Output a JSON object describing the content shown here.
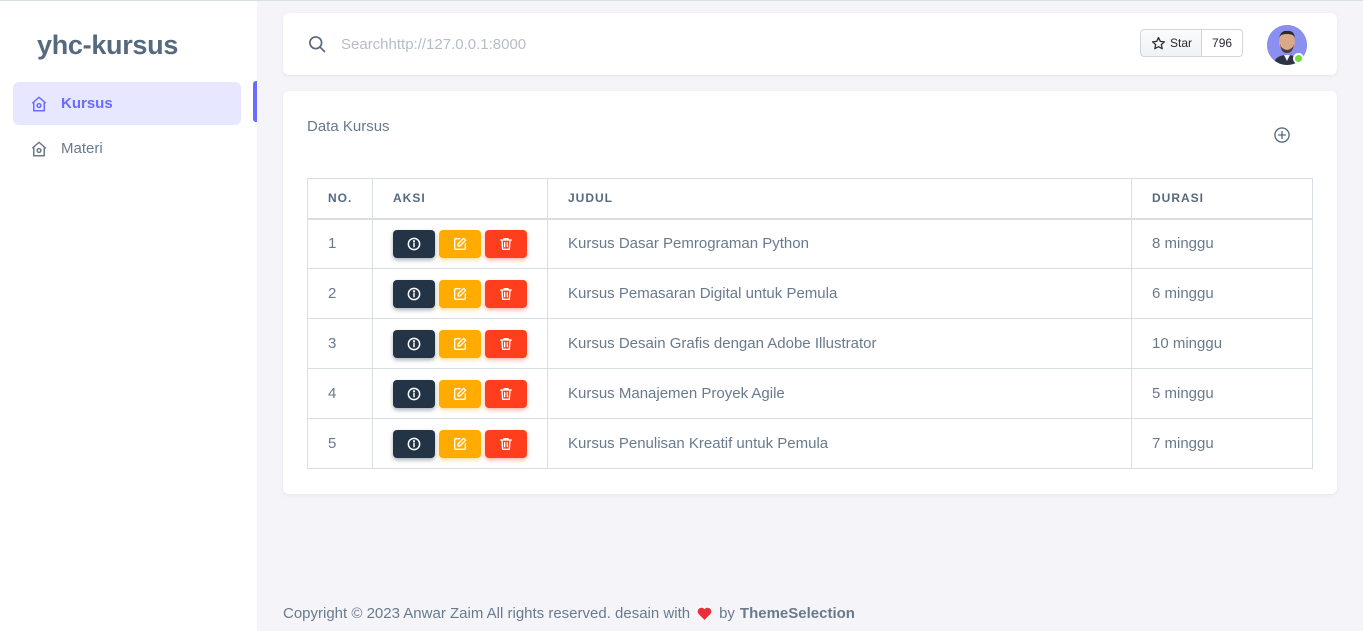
{
  "app": {
    "brand": "yhc-kursus"
  },
  "sidebar": {
    "items": [
      {
        "label": "Kursus",
        "icon": "home-icon",
        "active": true
      },
      {
        "label": "Materi",
        "icon": "home-icon",
        "active": false
      }
    ]
  },
  "navbar": {
    "search": {
      "value": "",
      "placeholder": "Searchhttp://127.0.0.1:8000"
    },
    "github": {
      "star_label": "Star",
      "count": "796"
    },
    "avatar": {
      "icon": "avatar",
      "online": true
    }
  },
  "card": {
    "title": "Data Kursus",
    "add_icon": "plus-circle-icon",
    "columns": [
      "NO.",
      "AKSI",
      "JUDUL",
      "DURASI"
    ],
    "rows": [
      {
        "no": "1",
        "judul": "Kursus Dasar Pemrograman Python",
        "durasi": "8 minggu"
      },
      {
        "no": "2",
        "judul": "Kursus Pemasaran Digital untuk Pemula",
        "durasi": "6 minggu"
      },
      {
        "no": "3",
        "judul": "Kursus Desain Grafis dengan Adobe Illustrator",
        "durasi": "10 minggu"
      },
      {
        "no": "4",
        "judul": "Kursus Manajemen Proyek Agile",
        "durasi": "5 minggu"
      },
      {
        "no": "5",
        "judul": "Kursus Penulisan Kreatif untuk Pemula",
        "durasi": "7 minggu"
      }
    ],
    "action_icons": [
      "info-icon",
      "edit-icon",
      "trash-icon"
    ]
  },
  "footer": {
    "text": "Copyright © 2023 Anwar Zaim All rights reserved. desain with",
    "by": "by",
    "link": "ThemeSelection"
  },
  "colors": {
    "primary": "#696cff",
    "info_btn": "#233446",
    "edit_btn": "#ffab00",
    "delete_btn": "#ff3e1d",
    "online": "#71dd37"
  }
}
